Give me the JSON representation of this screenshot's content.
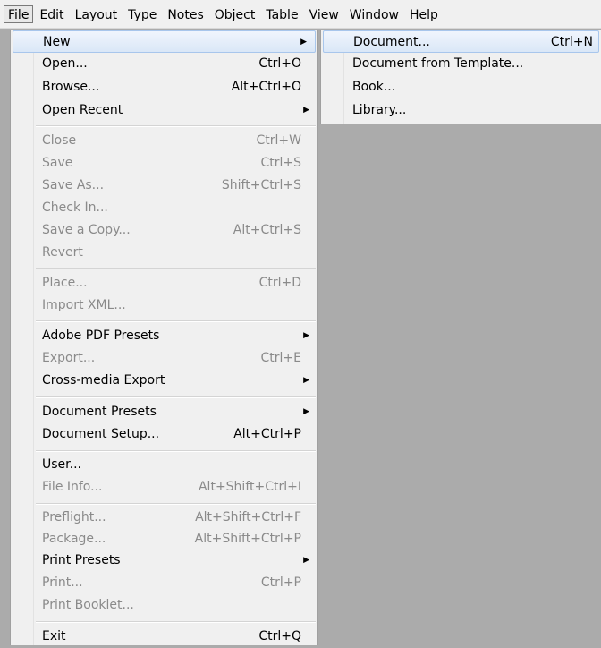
{
  "menubar": {
    "items": [
      "File",
      "Edit",
      "Layout",
      "Type",
      "Notes",
      "Object",
      "Table",
      "View",
      "Window",
      "Help"
    ],
    "active": "File"
  },
  "file_menu": {
    "new": {
      "label": "New"
    },
    "open": {
      "label": "Open...",
      "shortcut": "Ctrl+O"
    },
    "browse": {
      "label": "Browse...",
      "shortcut": "Alt+Ctrl+O"
    },
    "open_recent": {
      "label": "Open Recent"
    },
    "close": {
      "label": "Close",
      "shortcut": "Ctrl+W"
    },
    "save": {
      "label": "Save",
      "shortcut": "Ctrl+S"
    },
    "save_as": {
      "label": "Save As...",
      "shortcut": "Shift+Ctrl+S"
    },
    "check_in": {
      "label": "Check In..."
    },
    "save_copy": {
      "label": "Save a Copy...",
      "shortcut": "Alt+Ctrl+S"
    },
    "revert": {
      "label": "Revert"
    },
    "place": {
      "label": "Place...",
      "shortcut": "Ctrl+D"
    },
    "import_xml": {
      "label": "Import XML..."
    },
    "pdf_presets": {
      "label": "Adobe PDF Presets"
    },
    "export": {
      "label": "Export...",
      "shortcut": "Ctrl+E"
    },
    "cross_media": {
      "label": "Cross-media Export"
    },
    "doc_presets": {
      "label": "Document Presets"
    },
    "doc_setup": {
      "label": "Document Setup...",
      "shortcut": "Alt+Ctrl+P"
    },
    "user": {
      "label": "User..."
    },
    "file_info": {
      "label": "File Info...",
      "shortcut": "Alt+Shift+Ctrl+I"
    },
    "preflight": {
      "label": "Preflight...",
      "shortcut": "Alt+Shift+Ctrl+F"
    },
    "package": {
      "label": "Package...",
      "shortcut": "Alt+Shift+Ctrl+P"
    },
    "print_presets": {
      "label": "Print Presets"
    },
    "print": {
      "label": "Print...",
      "shortcut": "Ctrl+P"
    },
    "print_booklet": {
      "label": "Print Booklet..."
    },
    "exit": {
      "label": "Exit",
      "shortcut": "Ctrl+Q"
    }
  },
  "new_submenu": {
    "document": {
      "label": "Document...",
      "shortcut": "Ctrl+N"
    },
    "from_template": {
      "label": "Document from Template..."
    },
    "book": {
      "label": "Book..."
    },
    "library": {
      "label": "Library..."
    }
  }
}
